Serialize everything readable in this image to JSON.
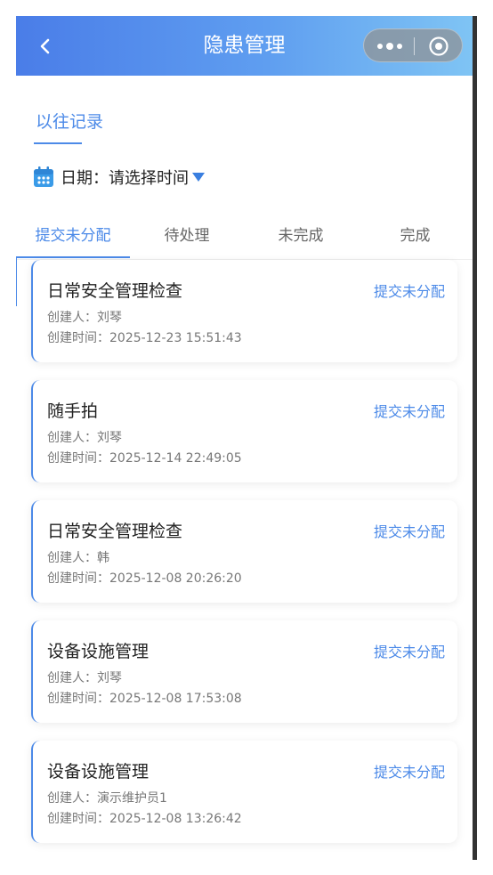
{
  "navbar": {
    "title": "隐患管理"
  },
  "section": {
    "title": "以往记录"
  },
  "date_filter": {
    "label": "日期：",
    "value": "请选择时间"
  },
  "tabs": [
    {
      "label": "提交未分配",
      "active": true
    },
    {
      "label": "待处理",
      "active": false
    },
    {
      "label": "未完成",
      "active": false
    },
    {
      "label": "完成",
      "active": false
    }
  ],
  "records": [
    {
      "title": "日常安全管理检查",
      "status": "提交未分配",
      "creator": "创建人：刘琴",
      "created_at": "创建时间：2025-12-23 15:51:43"
    },
    {
      "title": "随手拍",
      "status": "提交未分配",
      "creator": "创建人：刘琴",
      "created_at": "创建时间：2025-12-14 22:49:05"
    },
    {
      "title": "日常安全管理检查",
      "status": "提交未分配",
      "creator": "创建人：韩",
      "created_at": "创建时间：2025-12-08 20:26:20"
    },
    {
      "title": "设备设施管理",
      "status": "提交未分配",
      "creator": "创建人：刘琴",
      "created_at": "创建时间：2025-12-08 17:53:08"
    },
    {
      "title": "设备设施管理",
      "status": "提交未分配",
      "creator": "创建人：演示维护员1",
      "created_at": "创建时间：2025-12-08 13:26:42"
    }
  ],
  "colors": {
    "accent": "#4c8ae8",
    "navbar_start": "#4a7de8",
    "navbar_end": "#7fc4f4"
  },
  "icons": {
    "back": "chevron-left-icon",
    "more": "more-dots-icon",
    "close": "target-circle-icon",
    "calendar": "calendar-icon",
    "caret": "caret-down-icon"
  }
}
